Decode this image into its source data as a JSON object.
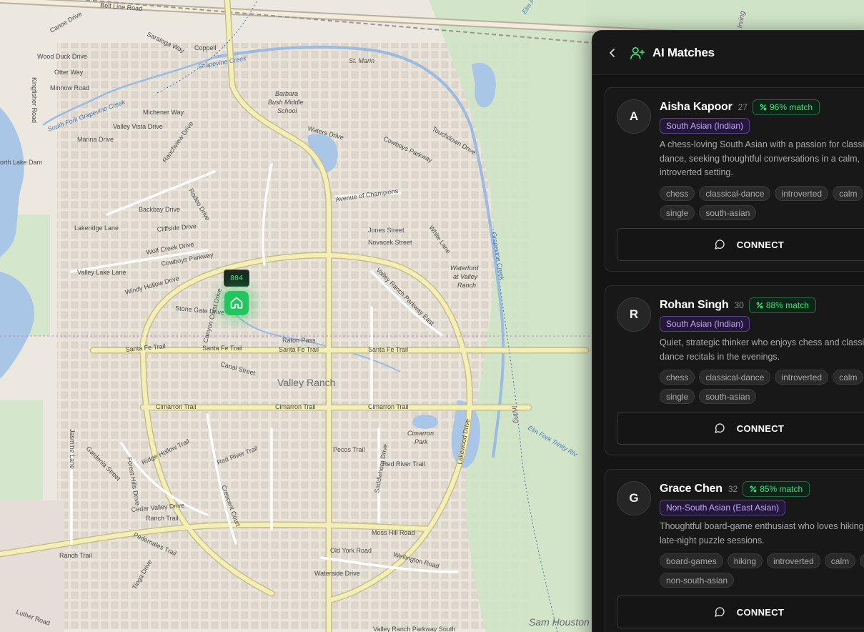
{
  "map": {
    "marker_label": "804",
    "labels": {
      "belt_line": "Belt Line Road",
      "coppell": "Coppell",
      "saratoga": "Saratoga Way",
      "st_marin": "St. Marin",
      "grapevine_creek": "Grapevine Creek",
      "school": "Barbara",
      "school2": "Bush Middle",
      "school3": "School",
      "canoe": "Canoe Drive",
      "wood_duck": "Wood Duck Drive",
      "otter": "Otter Way",
      "minnow": "Minnow Road",
      "kingfisher": "Kingfisher Road",
      "michener": "Michener Way",
      "sf_grapevine": "South Fork Grapevine Creek",
      "north_lake": "orth Lake Dam",
      "valley_vista": "Valley Vista Drive",
      "marina": "Marina Drive",
      "ranchview": "Ranchview Drive",
      "waters": "Waters Drive",
      "cowboys_pkwy": "Cowboys Parkway",
      "touchdown": "Touchdown Drive",
      "avenue_champions": "Avenue of Champions",
      "jones": "Jones Street",
      "novacek": "Novacek Street",
      "white_lane": "White Lane",
      "rodeo": "Rodeo Drive",
      "backbay": "Backbay Drive",
      "cliffside": "Cliffside Drive",
      "wolf_creek": "Wolf Creek Drive",
      "cowboys_pkwy2": "Cowboys Parkway",
      "lakeridge": "Lakeridge Lane",
      "valley_lake": "Valley Lake Lane",
      "windy_hollow": "Windy Hollow Drive",
      "stone_gate": "Stone Gate Drive",
      "canyon_crest": "Canyon Crest Drive",
      "raton": "Raton Pass",
      "santa_fe": "Santa Fe Trail",
      "canal": "Canal Street",
      "valley_ranch": "Valley Ranch",
      "vr_parkway_east": "Valley Ranch Parkway East",
      "waterford": "Waterford",
      "at_valley": "at Valley",
      "ranch": "Ranch",
      "grapevine_creek2": "Grapevine Creek",
      "cimarron": "Cimarron Trail",
      "cimarron_park": "Cimarron",
      "cimarron_park2": "Park",
      "pecos": "Pecos Trail",
      "red_river": "Red River Trail",
      "saddlehorn": "Saddlehorn Drive",
      "ridge_hollow": "Ridge Hollow Trail",
      "cedar_valley": "Cedar Valley Drive",
      "ranch_trail": "Ranch Trail",
      "moss_hill": "Moss Hill Road",
      "old_york": "Old York Road",
      "wellington": "Wellington Road",
      "waterside": "Waterside Drive",
      "vr_parkway_south": "Valley Ranch Parkway South",
      "irving": "Irving",
      "irving2": "Irving",
      "elm_fork": "Elm Fork Trinity Riv",
      "sam_houston": "Sam Houston",
      "lakewood": "Lakewood Drive",
      "jasmine": "Jasmine Lane",
      "gardenia": "Gardenia Street",
      "crescent": "Crescent Court",
      "luther": "Luther Road",
      "tioga": "Tioga Drive",
      "pedernales": "Pedernales Trail",
      "forest_hills": "Forest Hills Drive",
      "irving_top": "Irving",
      "elm_fork_top": "Elm Fork Trinity River"
    }
  },
  "panel": {
    "title": "AI Matches",
    "matches": [
      {
        "initial": "A",
        "name": "Aisha Kapoor",
        "age": "27",
        "match": "96% match",
        "ethnicity": "South Asian (Indian)",
        "description": "A chess-loving South Asian with a passion for classical dance, seeking thoughtful conversations in a calm, introverted setting.",
        "tags": [
          "chess",
          "classical-dance",
          "introverted",
          "calm",
          "single",
          "south-asian"
        ],
        "connect_label": "CONNECT"
      },
      {
        "initial": "R",
        "name": "Rohan Singh",
        "age": "30",
        "match": "88% match",
        "ethnicity": "South Asian (Indian)",
        "description": "Quiet, strategic thinker who enjoys chess and classical dance recitals in the evenings.",
        "tags": [
          "chess",
          "classical-dance",
          "introverted",
          "calm",
          "single",
          "south-asian"
        ],
        "connect_label": "CONNECT"
      },
      {
        "initial": "G",
        "name": "Grace Chen",
        "age": "32",
        "match": "85% match",
        "ethnicity": "Non-South Asian (East Asian)",
        "description": "Thoughtful board-game enthusiast who loves hiking and late-night puzzle sessions.",
        "tags": [
          "board-games",
          "hiking",
          "introverted",
          "calm",
          "single",
          "non-south-asian"
        ],
        "connect_label": "CONNECT"
      }
    ]
  },
  "colors": {
    "accent_green": "#3ee07a",
    "marker_green": "#22c55e",
    "ethnicity_purple": "#c5a8f5",
    "panel_bg": "#141414"
  },
  "icons": {
    "back": "chevron-left-icon",
    "header": "user-plus-icon",
    "match": "percent-icon",
    "connect": "message-circle-icon",
    "marker": "home-icon"
  }
}
